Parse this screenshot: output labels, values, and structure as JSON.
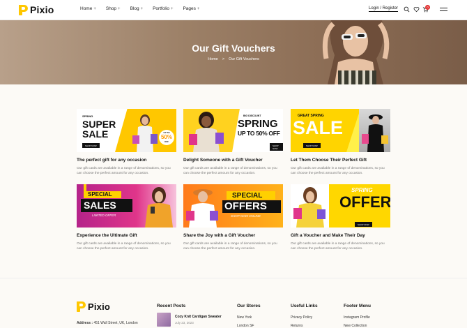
{
  "brand": {
    "name": "Pixio"
  },
  "nav": [
    {
      "label": "Home"
    },
    {
      "label": "Shop"
    },
    {
      "label": "Blog"
    },
    {
      "label": "Portfolio"
    },
    {
      "label": "Pages"
    }
  ],
  "nav_plus": "+",
  "header": {
    "login_label": "Login / Register",
    "cart_count": "0"
  },
  "hero": {
    "title": "Our Gift Vouchers",
    "breadcrumb": {
      "home": "Home",
      "separator": ">",
      "current": "Our Gift Vouchers"
    }
  },
  "cards": [
    {
      "title": "The perfect gift for any occasion",
      "desc": "Our gift cards are available in a range of denominations, so you can choose the perfect amount for any occasion.",
      "banner": {
        "line1": "SPRING",
        "line2": "SUPER",
        "line3": "SALE",
        "tag1": "UP TO",
        "tag2": "50%",
        "tag3": "OFF",
        "button": "SHOP NOW"
      }
    },
    {
      "title": "Delight Someone with a Gift Voucher",
      "desc": "Our gift cards are available in a range of denominations, so you can choose the perfect amount for any occasion.",
      "banner": {
        "line1": "BIG DISCOUNT",
        "line2": "SPRING",
        "line3": "UP TO 50% OFF",
        "button": "SHOP NOW"
      }
    },
    {
      "title": "Let Them Choose Their Perfect Gift",
      "desc": "Our gift cards are available in a range of denominations, so you can choose the perfect amount for any occasion.",
      "banner": {
        "line1": "GREAT SPRING",
        "line2": "SALE",
        "button": "SHOP NOW"
      }
    },
    {
      "title": "Experience the Ultimate Gift",
      "desc": "Our gift cards are available in a range of denominations, so you can choose the perfect amount for any occasion.",
      "banner": {
        "line1": "SPECIAL",
        "line2": "SALES",
        "line3": "LIMITED OFFER"
      }
    },
    {
      "title": "Share the Joy with a Gift Voucher",
      "desc": "Our gift cards are available in a range of denominations, so you can choose the perfect amount for any occasion.",
      "banner": {
        "line1": "SPECIAL",
        "line2": "OFFERS",
        "line3": "SHOP NOW ONLINE"
      }
    },
    {
      "title": "Gift a Voucher and Make Their Day",
      "desc": "Our gift cards are available in a range of denominations, so you can choose the perfect amount for any occasion.",
      "banner": {
        "line1": "SPRING",
        "line2": "OFFERS",
        "button": "SHOP NOW"
      }
    }
  ],
  "footer": {
    "address_label": "Address :",
    "address": "451 Wall Street, UK, London",
    "recent_posts": {
      "heading": "Recent Posts",
      "post_title": "Cozy Knit Cardigan Sweater",
      "post_date": "July 23, 2023"
    },
    "stores": {
      "heading": "Our Stores",
      "items": [
        "New York",
        "London SF"
      ]
    },
    "useful": {
      "heading": "Useful Links",
      "items": [
        "Privacy Policy",
        "Returns"
      ]
    },
    "menu": {
      "heading": "Footer Menu",
      "items": [
        "Instagram Profile",
        "New Collection"
      ]
    }
  },
  "colors": {
    "accent": "#ffc700",
    "pink": "#e0358a",
    "orange": "#ff7a1a",
    "badge": "#e32f2f"
  }
}
